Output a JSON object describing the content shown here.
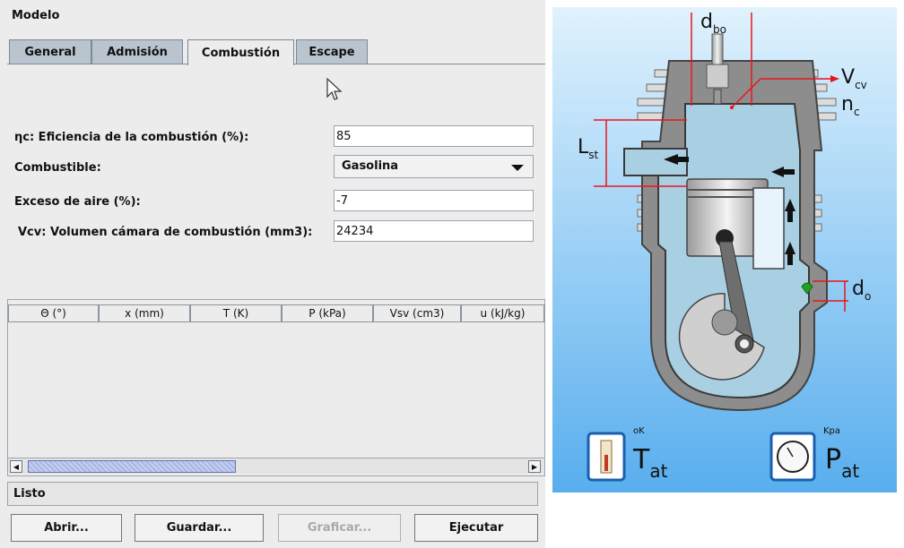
{
  "panel": {
    "title": "Modelo"
  },
  "tabs": [
    {
      "label": "General",
      "active": false
    },
    {
      "label": "Admisión",
      "active": false
    },
    {
      "label": "Combustión",
      "active": true
    },
    {
      "label": "Escape",
      "active": false
    }
  ],
  "form": {
    "efficiency": {
      "label": "ηc: Eficiencia de la combustión (%):",
      "value": "85"
    },
    "fuel": {
      "label": "Combustible:",
      "value": "Gasolina"
    },
    "excess_air": {
      "label": "Exceso de aire (%):",
      "value": "-7"
    },
    "volume": {
      "label": "Vcv: Volumen cámara de combustión (mm3):",
      "value": "24234"
    }
  },
  "table": {
    "columns": [
      "Θ (°)",
      "x (mm)",
      "T (K)",
      "P (kPa)",
      "Vsv (cm3)",
      "u (kJ/kg)"
    ],
    "rows": []
  },
  "status": {
    "text": "Listo"
  },
  "buttons": {
    "open": "Abrir...",
    "save": "Guardar...",
    "plot": "Graficar...",
    "run": "Ejecutar"
  },
  "diagram": {
    "labels": {
      "d_bo": {
        "main": "d",
        "sub": "bo"
      },
      "v_cv": {
        "main": "V",
        "sub": "cv"
      },
      "n_c": {
        "main": "n",
        "sub": "c"
      },
      "l_st": {
        "main": "L",
        "sub": "st"
      },
      "d_o": {
        "main": "d",
        "sub": "o"
      },
      "t_at": {
        "main": "T",
        "sub": "at",
        "unit": "oK"
      },
      "p_at": {
        "main": "P",
        "sub": "at",
        "unit": "Kpa"
      }
    },
    "colors": {
      "background_top": "#d8eefc",
      "background_bottom": "#5ab0ee",
      "accent_red": "#e8161c",
      "valve_green": "#1ea01e"
    }
  }
}
